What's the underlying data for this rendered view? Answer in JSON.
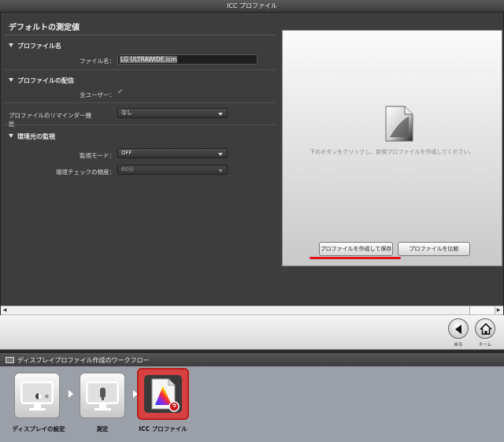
{
  "window": {
    "title": "ICC プロファイル"
  },
  "panel": {
    "title": "デフォルトの測定値",
    "profile_name": {
      "heading": "プロファイル名",
      "label": "ファイル名：",
      "value": "LG ULTRAWIDE.icm"
    },
    "distribution": {
      "heading": "プロファイルの配信",
      "all_users_label": "全ユーザー：",
      "all_users_checked": true,
      "reminder_label": "プロファイルのリマインダー機能",
      "reminder_value": "なし"
    },
    "ambient": {
      "heading": "環境光の監視",
      "mode_label": "監視モード：",
      "mode_value": "OFF",
      "frequency_label": "環境チェックの頻度：",
      "frequency_value": "60分"
    }
  },
  "preview": {
    "message": "下のボタンをクリックし、新規プロファイルを作成してください。",
    "create_button": "プロファイルを作成して保存",
    "compare_button": "プロファイルを比較"
  },
  "nav": {
    "back_label": "戻る",
    "home_label": "ホーム"
  },
  "workflow": {
    "title": "ディスプレイプロファイル作成のワークフロー",
    "steps": [
      {
        "label": "ディスプレイの設定",
        "icon": "display-settings-icon"
      },
      {
        "label": "測定",
        "icon": "measure-icon"
      },
      {
        "label": "ICC プロファイル",
        "icon": "icc-profile-icon",
        "active": true
      }
    ]
  },
  "colors": {
    "accent_red": "#e0141c",
    "active_step": "#d64040"
  }
}
